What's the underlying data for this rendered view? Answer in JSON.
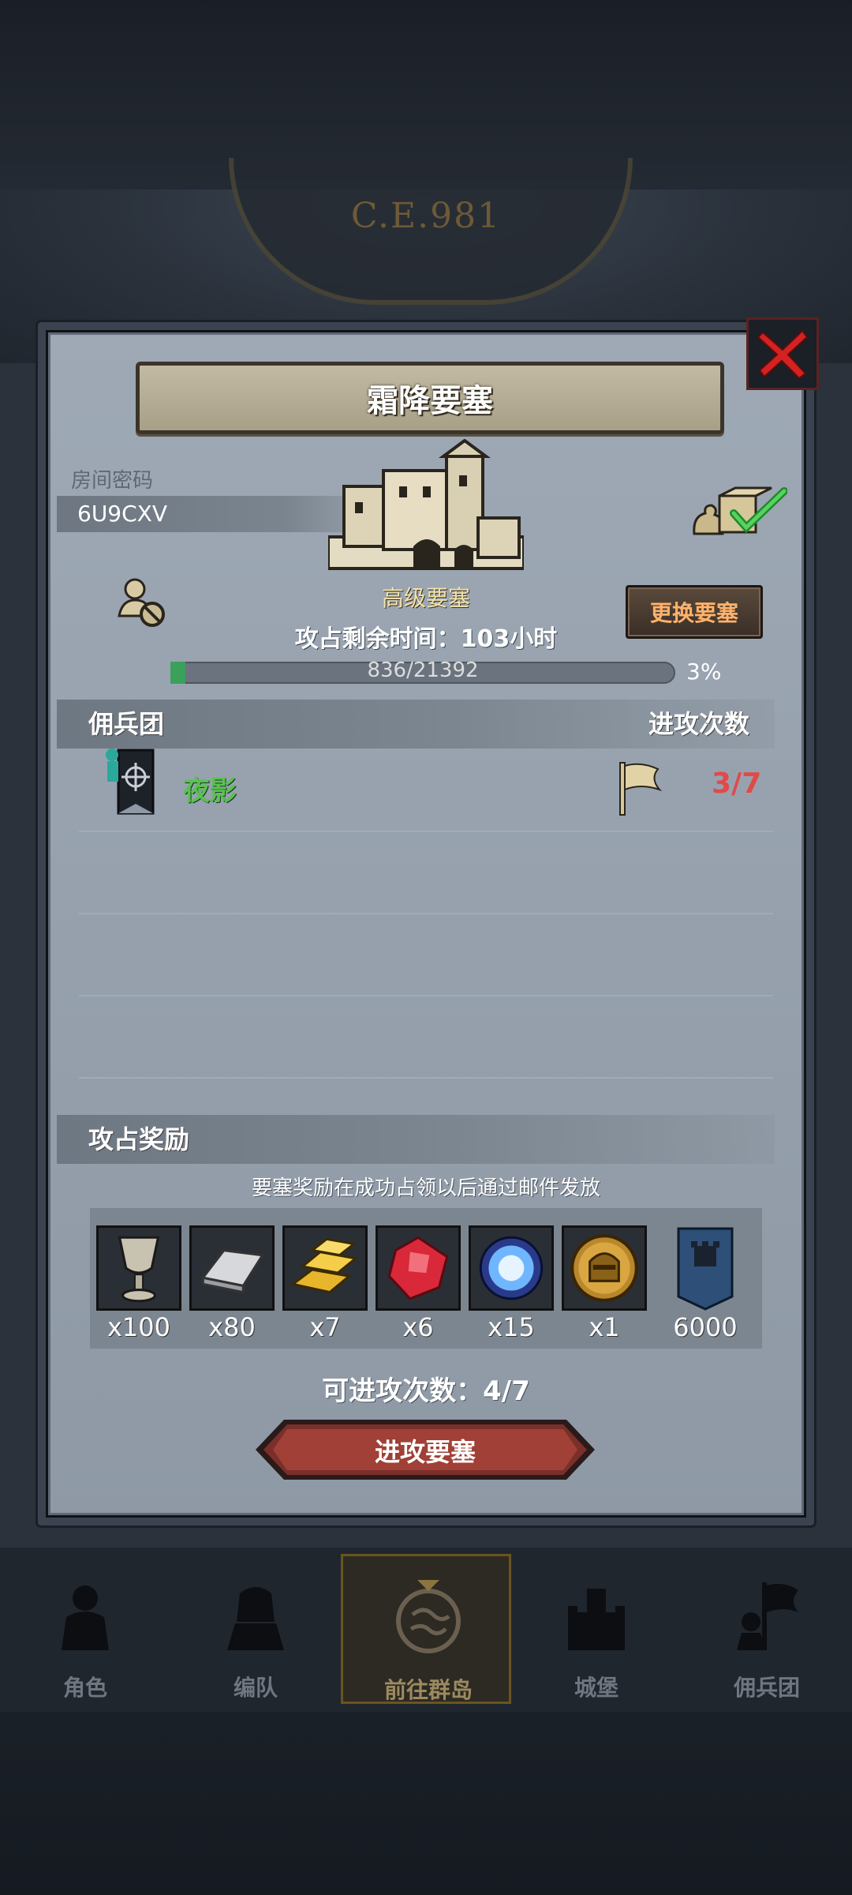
{
  "background": {
    "era": "C.E.981"
  },
  "modal": {
    "title": "霜降要塞",
    "room_label": "房间密码",
    "room_code": "6U9CXV",
    "fort_grade": "高级要塞",
    "change_button": "更换要塞",
    "time_label": "攻占剩余时间：",
    "time_value": "103",
    "time_unit": "小时",
    "progress": {
      "current_max": "836/21392",
      "fraction": 0.03,
      "percent": "3%"
    },
    "mercenary_header": "佣兵团",
    "attack_count_header": "进攻次数",
    "mercenaries": [
      {
        "name": "夜影",
        "count": "3/7",
        "icon": "mercenary-banner-icon"
      }
    ],
    "rewards_header": "攻占奖励",
    "rewards_note": "要塞奖励在成功占领以后通过邮件发放",
    "rewards": [
      {
        "icon": "goblet-icon",
        "qty": "x100"
      },
      {
        "icon": "silver-ingot-icon",
        "qty": "x80"
      },
      {
        "icon": "gold-bar-icon",
        "qty": "x7"
      },
      {
        "icon": "ruby-gem-icon",
        "qty": "x6"
      },
      {
        "icon": "blue-crystal-icon",
        "qty": "x15"
      },
      {
        "icon": "knight-coin-icon",
        "qty": "x1"
      },
      {
        "icon": "guild-banner-icon",
        "qty": "6000"
      }
    ],
    "attempts_label": "可进攻次数：",
    "attempts_value": "4/7",
    "attack_button": "进攻要塞"
  },
  "nav": [
    {
      "label": "角色",
      "icon": "character-icon",
      "active": false
    },
    {
      "label": "编队",
      "icon": "formation-icon",
      "active": false
    },
    {
      "label": "前往群岛",
      "icon": "islands-icon",
      "active": true
    },
    {
      "label": "城堡",
      "icon": "castle-icon",
      "active": false
    },
    {
      "label": "佣兵团",
      "icon": "mercenary-icon",
      "active": false
    }
  ],
  "colors": {
    "mercenary_name": "#59c24f",
    "attack_count": "#e04a4a",
    "change_button_text": "#ffb26b",
    "progress_fill": "#3aa05a"
  }
}
